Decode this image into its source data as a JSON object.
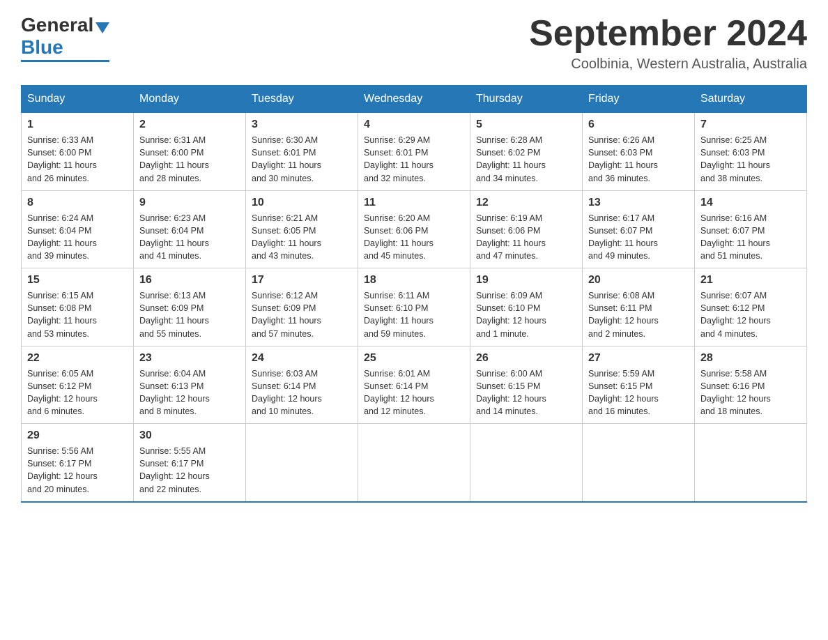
{
  "header": {
    "logo_general": "General",
    "logo_blue": "Blue",
    "month_title": "September 2024",
    "location": "Coolbinia, Western Australia, Australia"
  },
  "days_of_week": [
    "Sunday",
    "Monday",
    "Tuesday",
    "Wednesday",
    "Thursday",
    "Friday",
    "Saturday"
  ],
  "weeks": [
    [
      {
        "day": "1",
        "sunrise": "6:33 AM",
        "sunset": "6:00 PM",
        "daylight": "11 hours and 26 minutes."
      },
      {
        "day": "2",
        "sunrise": "6:31 AM",
        "sunset": "6:00 PM",
        "daylight": "11 hours and 28 minutes."
      },
      {
        "day": "3",
        "sunrise": "6:30 AM",
        "sunset": "6:01 PM",
        "daylight": "11 hours and 30 minutes."
      },
      {
        "day": "4",
        "sunrise": "6:29 AM",
        "sunset": "6:01 PM",
        "daylight": "11 hours and 32 minutes."
      },
      {
        "day": "5",
        "sunrise": "6:28 AM",
        "sunset": "6:02 PM",
        "daylight": "11 hours and 34 minutes."
      },
      {
        "day": "6",
        "sunrise": "6:26 AM",
        "sunset": "6:03 PM",
        "daylight": "11 hours and 36 minutes."
      },
      {
        "day": "7",
        "sunrise": "6:25 AM",
        "sunset": "6:03 PM",
        "daylight": "11 hours and 38 minutes."
      }
    ],
    [
      {
        "day": "8",
        "sunrise": "6:24 AM",
        "sunset": "6:04 PM",
        "daylight": "11 hours and 39 minutes."
      },
      {
        "day": "9",
        "sunrise": "6:23 AM",
        "sunset": "6:04 PM",
        "daylight": "11 hours and 41 minutes."
      },
      {
        "day": "10",
        "sunrise": "6:21 AM",
        "sunset": "6:05 PM",
        "daylight": "11 hours and 43 minutes."
      },
      {
        "day": "11",
        "sunrise": "6:20 AM",
        "sunset": "6:06 PM",
        "daylight": "11 hours and 45 minutes."
      },
      {
        "day": "12",
        "sunrise": "6:19 AM",
        "sunset": "6:06 PM",
        "daylight": "11 hours and 47 minutes."
      },
      {
        "day": "13",
        "sunrise": "6:17 AM",
        "sunset": "6:07 PM",
        "daylight": "11 hours and 49 minutes."
      },
      {
        "day": "14",
        "sunrise": "6:16 AM",
        "sunset": "6:07 PM",
        "daylight": "11 hours and 51 minutes."
      }
    ],
    [
      {
        "day": "15",
        "sunrise": "6:15 AM",
        "sunset": "6:08 PM",
        "daylight": "11 hours and 53 minutes."
      },
      {
        "day": "16",
        "sunrise": "6:13 AM",
        "sunset": "6:09 PM",
        "daylight": "11 hours and 55 minutes."
      },
      {
        "day": "17",
        "sunrise": "6:12 AM",
        "sunset": "6:09 PM",
        "daylight": "11 hours and 57 minutes."
      },
      {
        "day": "18",
        "sunrise": "6:11 AM",
        "sunset": "6:10 PM",
        "daylight": "11 hours and 59 minutes."
      },
      {
        "day": "19",
        "sunrise": "6:09 AM",
        "sunset": "6:10 PM",
        "daylight": "12 hours and 1 minute."
      },
      {
        "day": "20",
        "sunrise": "6:08 AM",
        "sunset": "6:11 PM",
        "daylight": "12 hours and 2 minutes."
      },
      {
        "day": "21",
        "sunrise": "6:07 AM",
        "sunset": "6:12 PM",
        "daylight": "12 hours and 4 minutes."
      }
    ],
    [
      {
        "day": "22",
        "sunrise": "6:05 AM",
        "sunset": "6:12 PM",
        "daylight": "12 hours and 6 minutes."
      },
      {
        "day": "23",
        "sunrise": "6:04 AM",
        "sunset": "6:13 PM",
        "daylight": "12 hours and 8 minutes."
      },
      {
        "day": "24",
        "sunrise": "6:03 AM",
        "sunset": "6:14 PM",
        "daylight": "12 hours and 10 minutes."
      },
      {
        "day": "25",
        "sunrise": "6:01 AM",
        "sunset": "6:14 PM",
        "daylight": "12 hours and 12 minutes."
      },
      {
        "day": "26",
        "sunrise": "6:00 AM",
        "sunset": "6:15 PM",
        "daylight": "12 hours and 14 minutes."
      },
      {
        "day": "27",
        "sunrise": "5:59 AM",
        "sunset": "6:15 PM",
        "daylight": "12 hours and 16 minutes."
      },
      {
        "day": "28",
        "sunrise": "5:58 AM",
        "sunset": "6:16 PM",
        "daylight": "12 hours and 18 minutes."
      }
    ],
    [
      {
        "day": "29",
        "sunrise": "5:56 AM",
        "sunset": "6:17 PM",
        "daylight": "12 hours and 20 minutes."
      },
      {
        "day": "30",
        "sunrise": "5:55 AM",
        "sunset": "6:17 PM",
        "daylight": "12 hours and 22 minutes."
      },
      null,
      null,
      null,
      null,
      null
    ]
  ],
  "labels": {
    "sunrise": "Sunrise:",
    "sunset": "Sunset:",
    "daylight": "Daylight:"
  }
}
